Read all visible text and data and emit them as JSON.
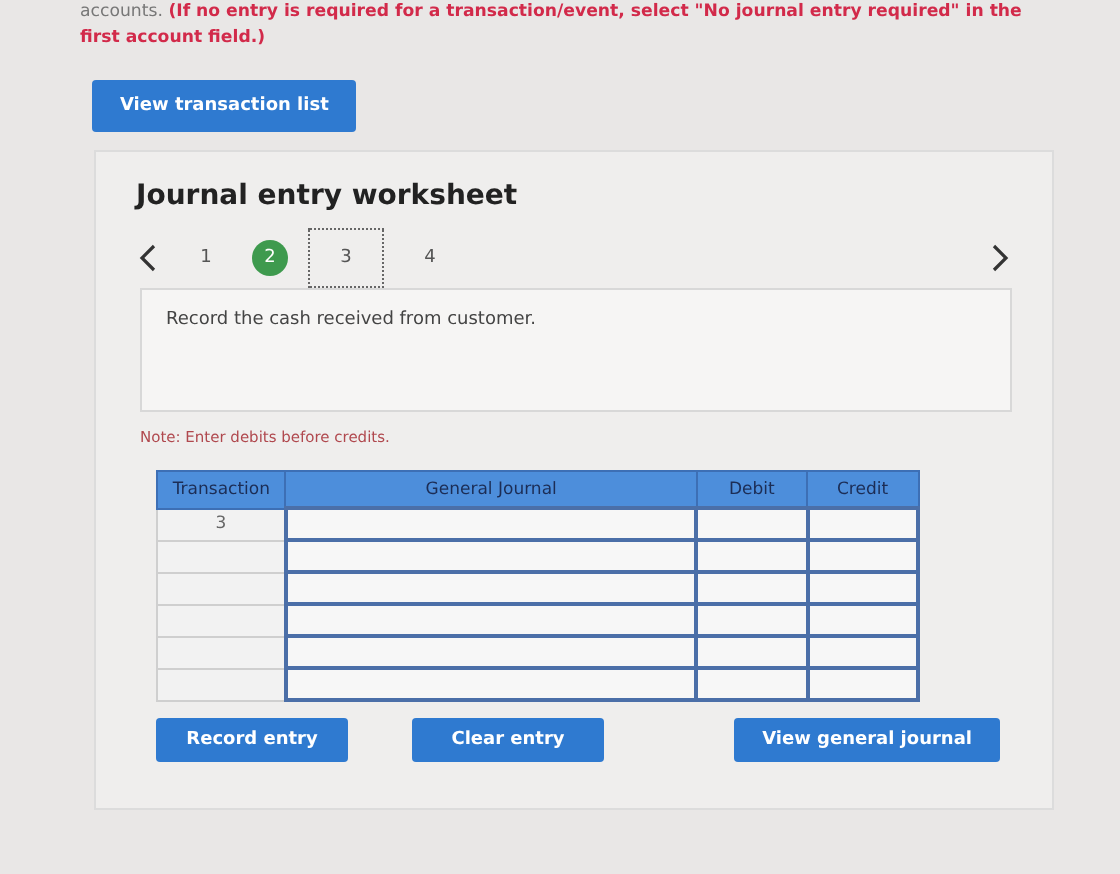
{
  "instruction": "accounts. **(If no entry is required for a transaction/event, select \"No journal entry required\" in the first account field.)**",
  "view_transaction_list": "View transaction list",
  "worksheet": {
    "title": "Journal entry worksheet",
    "steps": [
      {
        "label": "1",
        "selected": false,
        "focused": false
      },
      {
        "label": "2",
        "selected": true,
        "focused": false
      },
      {
        "label": "3",
        "selected": false,
        "focused": true
      },
      {
        "label": "4",
        "selected": false,
        "focused": false
      }
    ],
    "prompt": "Record the cash received from customer.",
    "note": "Note: Enter debits before credits.",
    "table": {
      "columns": [
        "Transaction",
        "General Journal",
        "Debit",
        "Credit"
      ],
      "rows": [
        {
          "transaction": "3"
        },
        {},
        {},
        {},
        {},
        {}
      ]
    },
    "buttons": [
      {
        "label": "Record entry",
        "kind": "left"
      },
      {
        "label": "Clear entry",
        "kind": "left"
      },
      {
        "label": "View general journal",
        "kind": "right"
      }
    ]
  }
}
